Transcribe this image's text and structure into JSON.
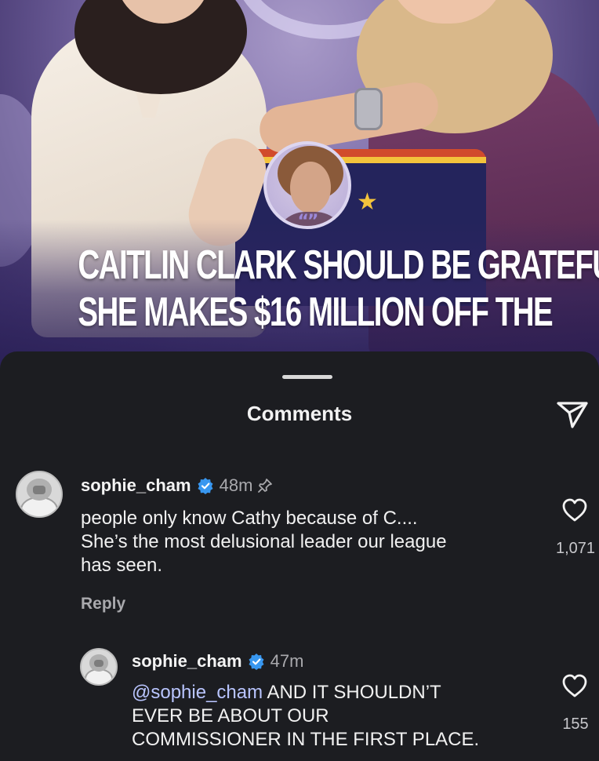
{
  "post": {
    "quote_glyph": "“”",
    "headline_line1": "CAITLIN CLARK SHOULD BE GRATEFUL",
    "headline_line2": "SHE MAKES $16 MILLION OFF THE"
  },
  "sheet": {
    "title": "Comments"
  },
  "comments": [
    {
      "username": "sophie_cham",
      "time": "48m",
      "text_line1": "people only know Cathy because of C....",
      "text_line2": "She’s the most delusional leader our league",
      "text_line3": "has seen.",
      "reply_label": "Reply",
      "likes": "1,071"
    },
    {
      "username": "sophie_cham",
      "time": "47m",
      "mention": "@sophie_cham",
      "text_line1_rest": " AND IT SHOULDN’T",
      "text_line2": "EVER BE ABOUT OUR",
      "text_line3": "COMMISSIONER IN THE FIRST PLACE.",
      "likes": "155"
    }
  ],
  "colors": {
    "sheet_bg": "#1c1d21",
    "verified_badge": "#3897f0",
    "mention": "#b9c5ff",
    "secondary_text": "#a9a9ad"
  },
  "icons": [
    "share-icon",
    "verified-badge-icon",
    "pin-icon",
    "heart-icon"
  ]
}
